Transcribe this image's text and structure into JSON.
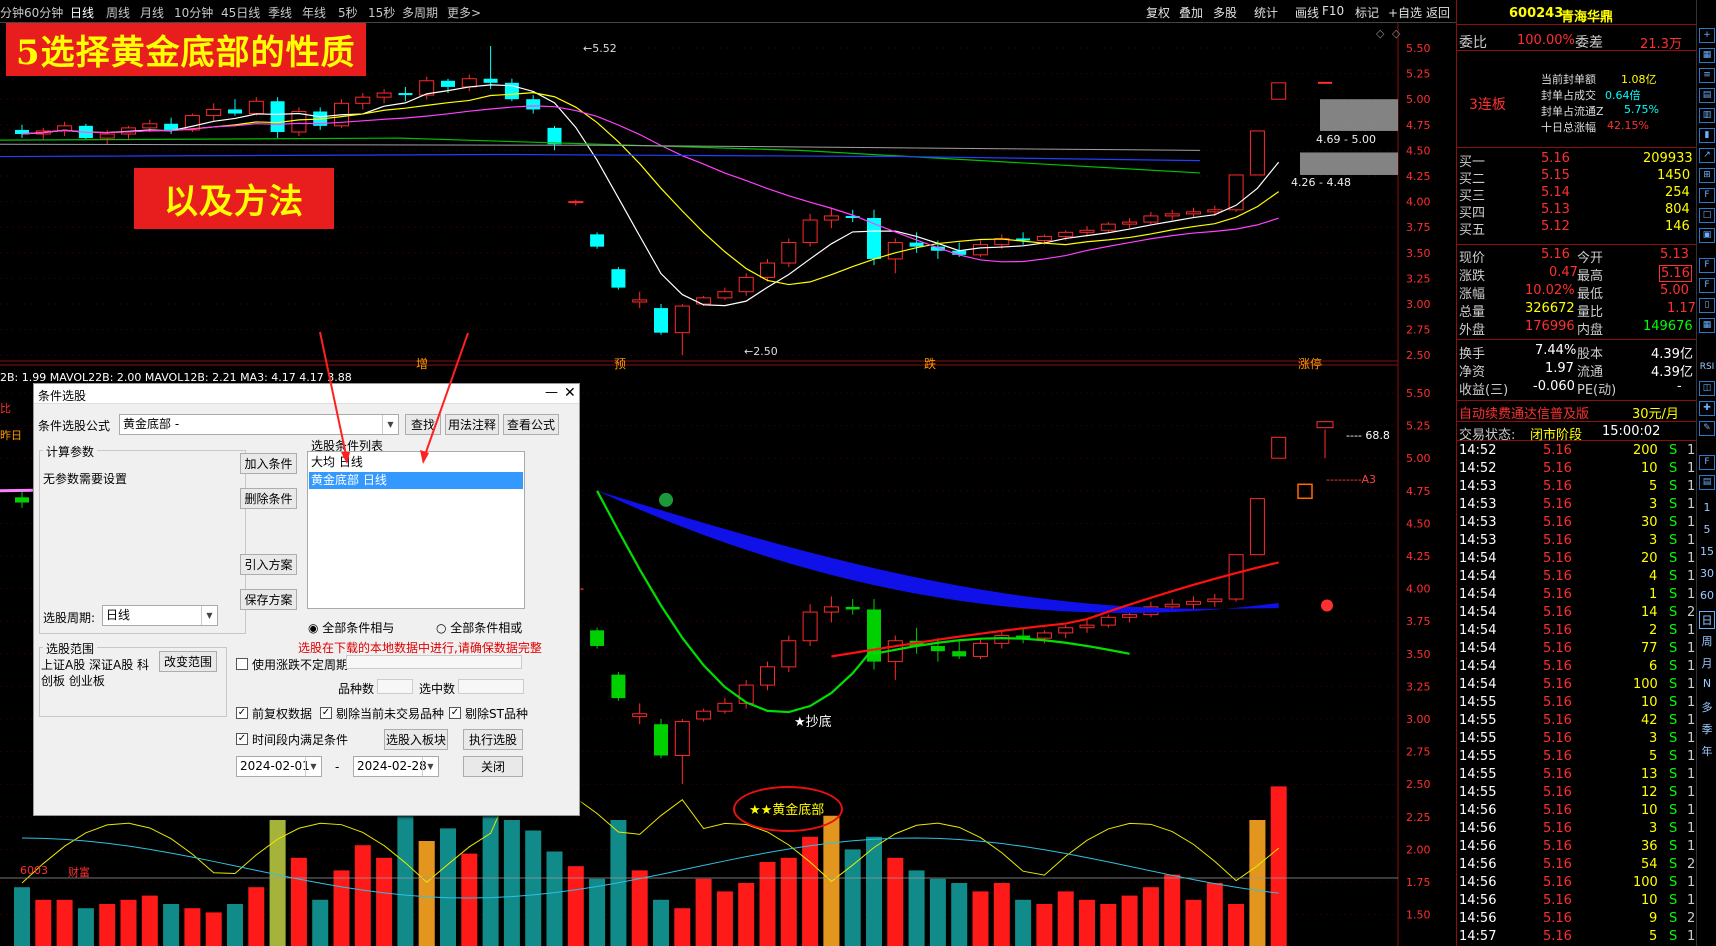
{
  "periods": [
    "分钟",
    "60分钟",
    "日线",
    "周线",
    "月线",
    "10分钟",
    "45日线",
    "季线",
    "年线",
    "5秒",
    "15秒",
    "多周期",
    "更多>"
  ],
  "active_period": "日线",
  "toolbar_right": [
    "复权",
    "叠加",
    "多股",
    "统计",
    "画线",
    "F10",
    "标记",
    "+自选",
    "返回"
  ],
  "titles": {
    "main": "5选择黄金底部的性质",
    "sub": "以及方法"
  },
  "price_axis_top": [
    "5.50",
    "5.25",
    "5.00",
    "4.75",
    "4.50",
    "4.25",
    "4.00",
    "3.75",
    "3.50",
    "3.25",
    "3.00",
    "2.75",
    "2.50"
  ],
  "price_axis_bottom": [
    "5.50",
    "5.25",
    "5.00",
    "4.75",
    "4.50",
    "4.25",
    "4.00",
    "3.75",
    "3.50",
    "3.25",
    "3.00",
    "2.75",
    "2.50",
    "2.25",
    "2.00",
    "1.75",
    "1.50"
  ],
  "chart_annotations": {
    "high_label": "5.52",
    "low_label": "2.50",
    "range_high": "4.69 - 5.00",
    "range_low": "4.26 - 4.48",
    "marks": [
      "增",
      "预",
      "跌",
      "涨停"
    ],
    "top_val": "68.8",
    "a3": "A3",
    "chaodi": "★抄底",
    "gold": "★★黄金底部",
    "fragment_bi": "比",
    "fragment_zuori": "昨日",
    "fragment_left": "6003",
    "fragment_cai": "财富"
  },
  "indicator_line": "2B: 1.99  MAVOL22B: 2.00  MAVOL12B: 2.21  MA3: 4.17  4.17  3.88",
  "dialog": {
    "title": "条件选股",
    "formula_label": "条件选股公式",
    "formula_value": "黄金底部  -",
    "btn_view": "查找",
    "btn_usage": "用法注释",
    "btn_formula": "查看公式",
    "params_group": "计算参数",
    "params_text": "无参数需要设置",
    "btn_add": "加入条件",
    "btn_delete": "删除条件",
    "btn_import": "引入方案",
    "btn_save": "保存方案",
    "list_title": "选股条件列表",
    "list_items": [
      "大均  日线",
      "黄金底部  日线"
    ],
    "period_label": "选股周期:",
    "period_value": "日线",
    "radio_all_and": "全部条件相与",
    "radio_all_or": "全部条件相或",
    "warn": "选股在下载的本地数据中进行,请确保数据完整",
    "scope_group": "选股范围",
    "scope_text_1": "上证A股 深证A股 科",
    "scope_text_2": "创板 创业板",
    "btn_scope": "改变范围",
    "check_unfixed": "使用涨跌不定周期",
    "count_label": "品种数",
    "selected_label": "选中数",
    "check_fq": "前复权数据",
    "check_no_trade": "剔除当前未交易品种",
    "check_st": "剔除ST品种",
    "check_time": "时间段内满足条件",
    "btn_to_block": "选股入板块",
    "btn_exec": "执行选股",
    "date_from": "2024-02-01",
    "date_sep": "-",
    "date_to": "2024-02-28",
    "btn_close": "关闭"
  },
  "side": {
    "code": "600243",
    "name": "青海华鼎",
    "weibi_label": "委比",
    "weibi_val": "100.00%",
    "weicha_label": "委差",
    "weicha_val": "21.3万",
    "lianban": "3连板",
    "info": [
      {
        "label": "当前封单额",
        "val": "1.08亿"
      },
      {
        "label": "封单占成交",
        "val": "0.64倍"
      },
      {
        "label": "封单占流通Z",
        "val": "5.75%"
      },
      {
        "label": "十日总涨幅",
        "val": "42.15%"
      }
    ],
    "bids": [
      {
        "label": "买一",
        "price": "5.16",
        "vol": "209933"
      },
      {
        "label": "买二",
        "price": "5.15",
        "vol": "1450"
      },
      {
        "label": "买三",
        "price": "5.14",
        "vol": "254"
      },
      {
        "label": "买四",
        "price": "5.13",
        "vol": "804"
      },
      {
        "label": "买五",
        "price": "5.12",
        "vol": "146"
      }
    ],
    "stats": [
      {
        "l1": "现价",
        "v1": "5.16",
        "l2": "今开",
        "v2": "5.13"
      },
      {
        "l1": "涨跌",
        "v1": "0.47",
        "l2": "最高",
        "v2": "5.16"
      },
      {
        "l1": "涨幅",
        "v1": "10.02%",
        "l2": "最低",
        "v2": "5.00"
      },
      {
        "l1": "总量",
        "v1": "326672",
        "l2": "量比",
        "v2": "1.17"
      },
      {
        "l1": "外盘",
        "v1": "176996",
        "l2": "内盘",
        "v2": "149676"
      }
    ],
    "stats2": [
      {
        "l1": "换手",
        "v1": "7.44%",
        "l2": "股本",
        "v2": "4.39亿"
      },
      {
        "l1": "净资",
        "v1": "1.97",
        "l2": "流通",
        "v2": "4.39亿"
      },
      {
        "l1": "收益(三)",
        "v1": "-0.060",
        "l2": "PE(动)",
        "v2": "-"
      }
    ],
    "ad_text": "自动续费通达信普及版",
    "ad_price": "30元/月",
    "trade_state_label": "交易状态:",
    "trade_state_val": "闭市阶段",
    "trade_time": "15:00:02",
    "ticks": [
      [
        "14:52",
        "5.16",
        "200",
        "S",
        "1"
      ],
      [
        "14:52",
        "5.16",
        "10",
        "S",
        "1"
      ],
      [
        "14:53",
        "5.16",
        "5",
        "S",
        "1"
      ],
      [
        "14:53",
        "5.16",
        "3",
        "S",
        "1"
      ],
      [
        "14:53",
        "5.16",
        "30",
        "S",
        "1"
      ],
      [
        "14:53",
        "5.16",
        "3",
        "S",
        "1"
      ],
      [
        "14:54",
        "5.16",
        "20",
        "S",
        "1"
      ],
      [
        "14:54",
        "5.16",
        "4",
        "S",
        "1"
      ],
      [
        "14:54",
        "5.16",
        "1",
        "S",
        "1"
      ],
      [
        "14:54",
        "5.16",
        "14",
        "S",
        "2"
      ],
      [
        "14:54",
        "5.16",
        "2",
        "S",
        "1"
      ],
      [
        "14:54",
        "5.16",
        "77",
        "S",
        "1"
      ],
      [
        "14:54",
        "5.16",
        "6",
        "S",
        "1"
      ],
      [
        "14:54",
        "5.16",
        "100",
        "S",
        "1"
      ],
      [
        "14:55",
        "5.16",
        "10",
        "S",
        "1"
      ],
      [
        "14:55",
        "5.16",
        "42",
        "S",
        "1"
      ],
      [
        "14:55",
        "5.16",
        "3",
        "S",
        "1"
      ],
      [
        "14:55",
        "5.16",
        "5",
        "S",
        "1"
      ],
      [
        "14:55",
        "5.16",
        "13",
        "S",
        "1"
      ],
      [
        "14:55",
        "5.16",
        "12",
        "S",
        "1"
      ],
      [
        "14:56",
        "5.16",
        "10",
        "S",
        "1"
      ],
      [
        "14:56",
        "5.16",
        "3",
        "S",
        "1"
      ],
      [
        "14:56",
        "5.16",
        "36",
        "S",
        "1"
      ],
      [
        "14:56",
        "5.16",
        "54",
        "S",
        "2"
      ],
      [
        "14:56",
        "5.16",
        "100",
        "S",
        "1"
      ],
      [
        "14:56",
        "5.16",
        "10",
        "S",
        "1"
      ],
      [
        "14:56",
        "5.16",
        "9",
        "S",
        "2"
      ],
      [
        "14:57",
        "5.16",
        "5",
        "S",
        "1"
      ]
    ]
  },
  "icon_col": [
    "RSI",
    "1",
    "5",
    "15",
    "30",
    "60",
    "日",
    "周",
    "月",
    "N",
    "多",
    "季",
    "年"
  ],
  "colors": {
    "up": "#ff2a2a",
    "down": "#00ffff",
    "down2": "#00d000",
    "accent_yellow": "#ffff00",
    "dialog_bg": "#f0f0f0"
  }
}
